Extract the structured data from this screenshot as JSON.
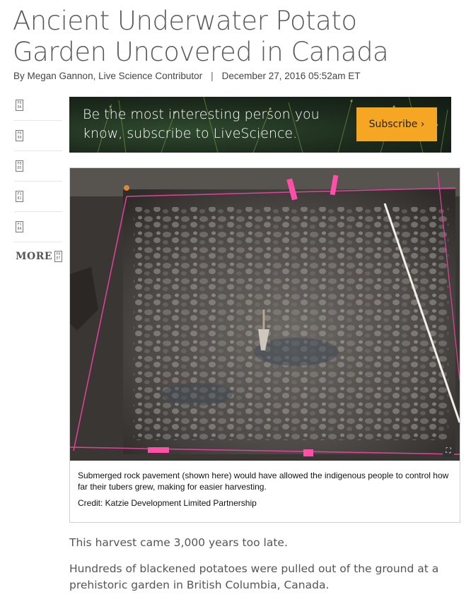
{
  "article": {
    "headline": "Ancient Underwater Potato Garden Uncovered in Canada",
    "byline_author": "By Megan Gannon, Live Science Contributor",
    "byline_separator": "|",
    "byline_date": "December 27, 2016 05:52am ET"
  },
  "share_rail": {
    "items": [
      {
        "glyph": "F0 9A"
      },
      {
        "glyph": "F0 99"
      },
      {
        "glyph": "F0 D5"
      },
      {
        "glyph": "F1 81"
      },
      {
        "glyph": "F1 8A"
      }
    ],
    "more_label": "MORE",
    "more_glyph": "F0 E7"
  },
  "ad": {
    "text": "Be the most interesting person you know, subscribe to LiveScience.",
    "button_label": "Subscribe ›",
    "button_color": "#f5a623"
  },
  "figure": {
    "expand_glyph": "⛶",
    "caption": "Submerged rock pavement (shown here) would have allowed the indigenous people to control how far their tubers grew, making for easier harvesting.",
    "credit": "Credit: Katzie Development Limited Partnership"
  },
  "body": {
    "paragraph_1": "This harvest came 3,000 years too late.",
    "paragraph_2": "Hundreds of blackened potatoes were pulled out of the ground at a prehistoric garden in British Columbia, Canada."
  }
}
